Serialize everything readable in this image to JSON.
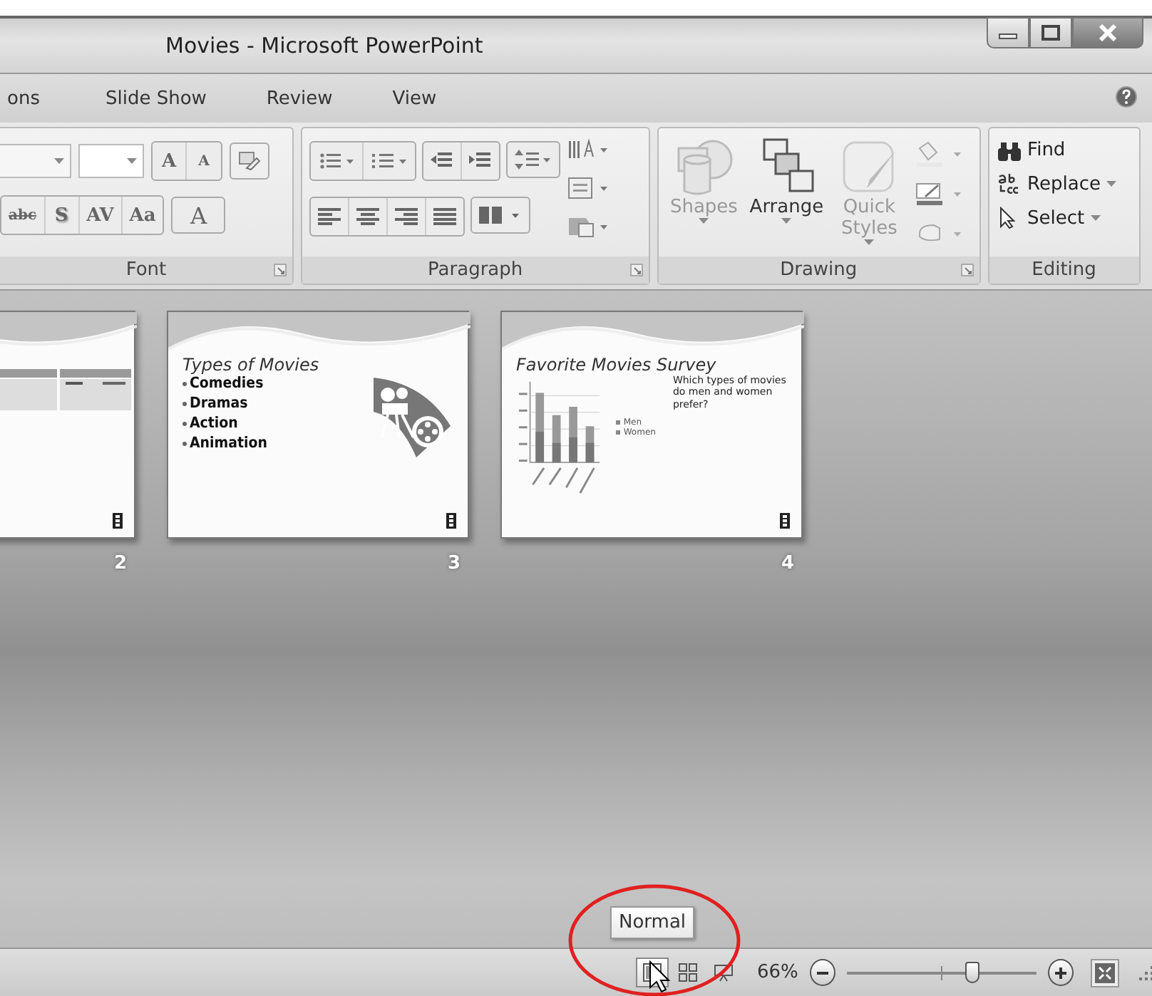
{
  "window": {
    "title": "Movies - Microsoft PowerPoint"
  },
  "tabs": [
    {
      "label": "ons",
      "selected": false
    },
    {
      "label": "Slide Show",
      "selected": false
    },
    {
      "label": "Review",
      "selected": false
    },
    {
      "label": "View",
      "selected": false
    }
  ],
  "ribbon": {
    "groups": [
      {
        "kind": "font",
        "label": "Font",
        "row1": [
          "A",
          "A"
        ],
        "row2": [
          "abc",
          "S",
          "AV",
          "Aa",
          "A"
        ]
      },
      {
        "kind": "paragraph",
        "label": "Paragraph"
      },
      {
        "kind": "drawing",
        "label": "Drawing",
        "buttons": [
          {
            "label": "Shapes",
            "disabled": true
          },
          {
            "label": "Arrange",
            "disabled": false
          },
          {
            "label": "Quick Styles",
            "disabled": true
          }
        ]
      },
      {
        "kind": "editing",
        "label": "Editing",
        "buttons": [
          {
            "label": "Find",
            "dropdown": false
          },
          {
            "label": "Replace",
            "dropdown": true
          },
          {
            "label": "Select",
            "dropdown": true
          }
        ]
      }
    ]
  },
  "slides": [
    {
      "kind": "table",
      "number": "2"
    },
    {
      "kind": "bullets",
      "number": "3",
      "title": "Types of Movies",
      "bullets": [
        "Comedies",
        "Dramas",
        "Action",
        "Animation"
      ]
    },
    {
      "kind": "chart",
      "number": "4",
      "title": "Favorite Movies Survey",
      "question": "Which types of movies do men and women prefer?",
      "legend": [
        "Men",
        "Women"
      ]
    }
  ],
  "tooltip": "Normal",
  "status_bar": {
    "views": [
      {
        "kind": "normal",
        "hovered": true
      },
      {
        "kind": "sorter",
        "hovered": false
      },
      {
        "kind": "show",
        "hovered": false
      }
    ],
    "zoom": "66%",
    "level": 0.66
  }
}
